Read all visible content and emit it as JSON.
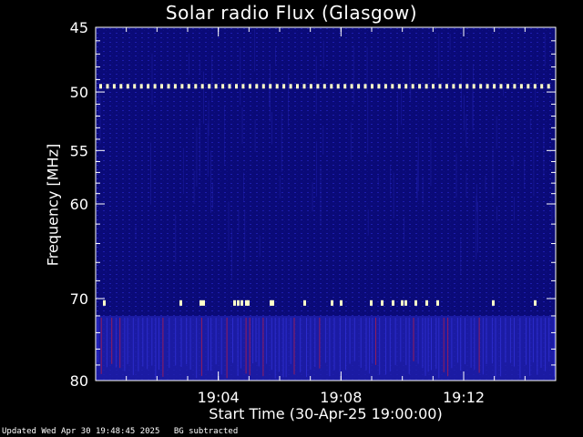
{
  "chart_data": {
    "type": "heatmap",
    "title": "Solar radio Flux (Glasgow)",
    "ylabel": "Frequency [MHz]",
    "xlabel": "Start Time (30-Apr-25 19:00:00)",
    "y_scale": "log",
    "y_range": [
      45,
      80
    ],
    "y_ticks": [
      {
        "value": 45,
        "label": "45"
      },
      {
        "value": 50,
        "label": "50"
      },
      {
        "value": 55,
        "label": "55"
      },
      {
        "value": 60,
        "label": "60"
      },
      {
        "value": 70,
        "label": "70"
      },
      {
        "value": 80,
        "label": "80"
      }
    ],
    "x_range": [
      "19:00:00",
      "19:15:00"
    ],
    "x_ticks": [
      {
        "value": "19:04",
        "label": "19:04"
      },
      {
        "value": "19:08",
        "label": "19:08"
      },
      {
        "value": "19:12",
        "label": "19:12"
      }
    ],
    "colormap": [
      "#0a0a78",
      "#1e1eaa",
      "#3232dc",
      "#c81e3c",
      "#ffff96",
      "#ffffff"
    ],
    "background": "#000000",
    "interference_bands": [
      {
        "frequency_mhz": 49.5,
        "type": "periodic dots",
        "color": "#ffffc8"
      },
      {
        "frequency_mhz": 70.5,
        "type": "intermittent bursts",
        "color": "#ffffc8"
      },
      {
        "frequency_mhz": [
          72,
          80
        ],
        "type": "brighter band",
        "color": "#3232dc"
      }
    ]
  },
  "footer": {
    "updated": "Updated Wed Apr 30 19:48:45 2025",
    "note": "BG subtracted"
  }
}
